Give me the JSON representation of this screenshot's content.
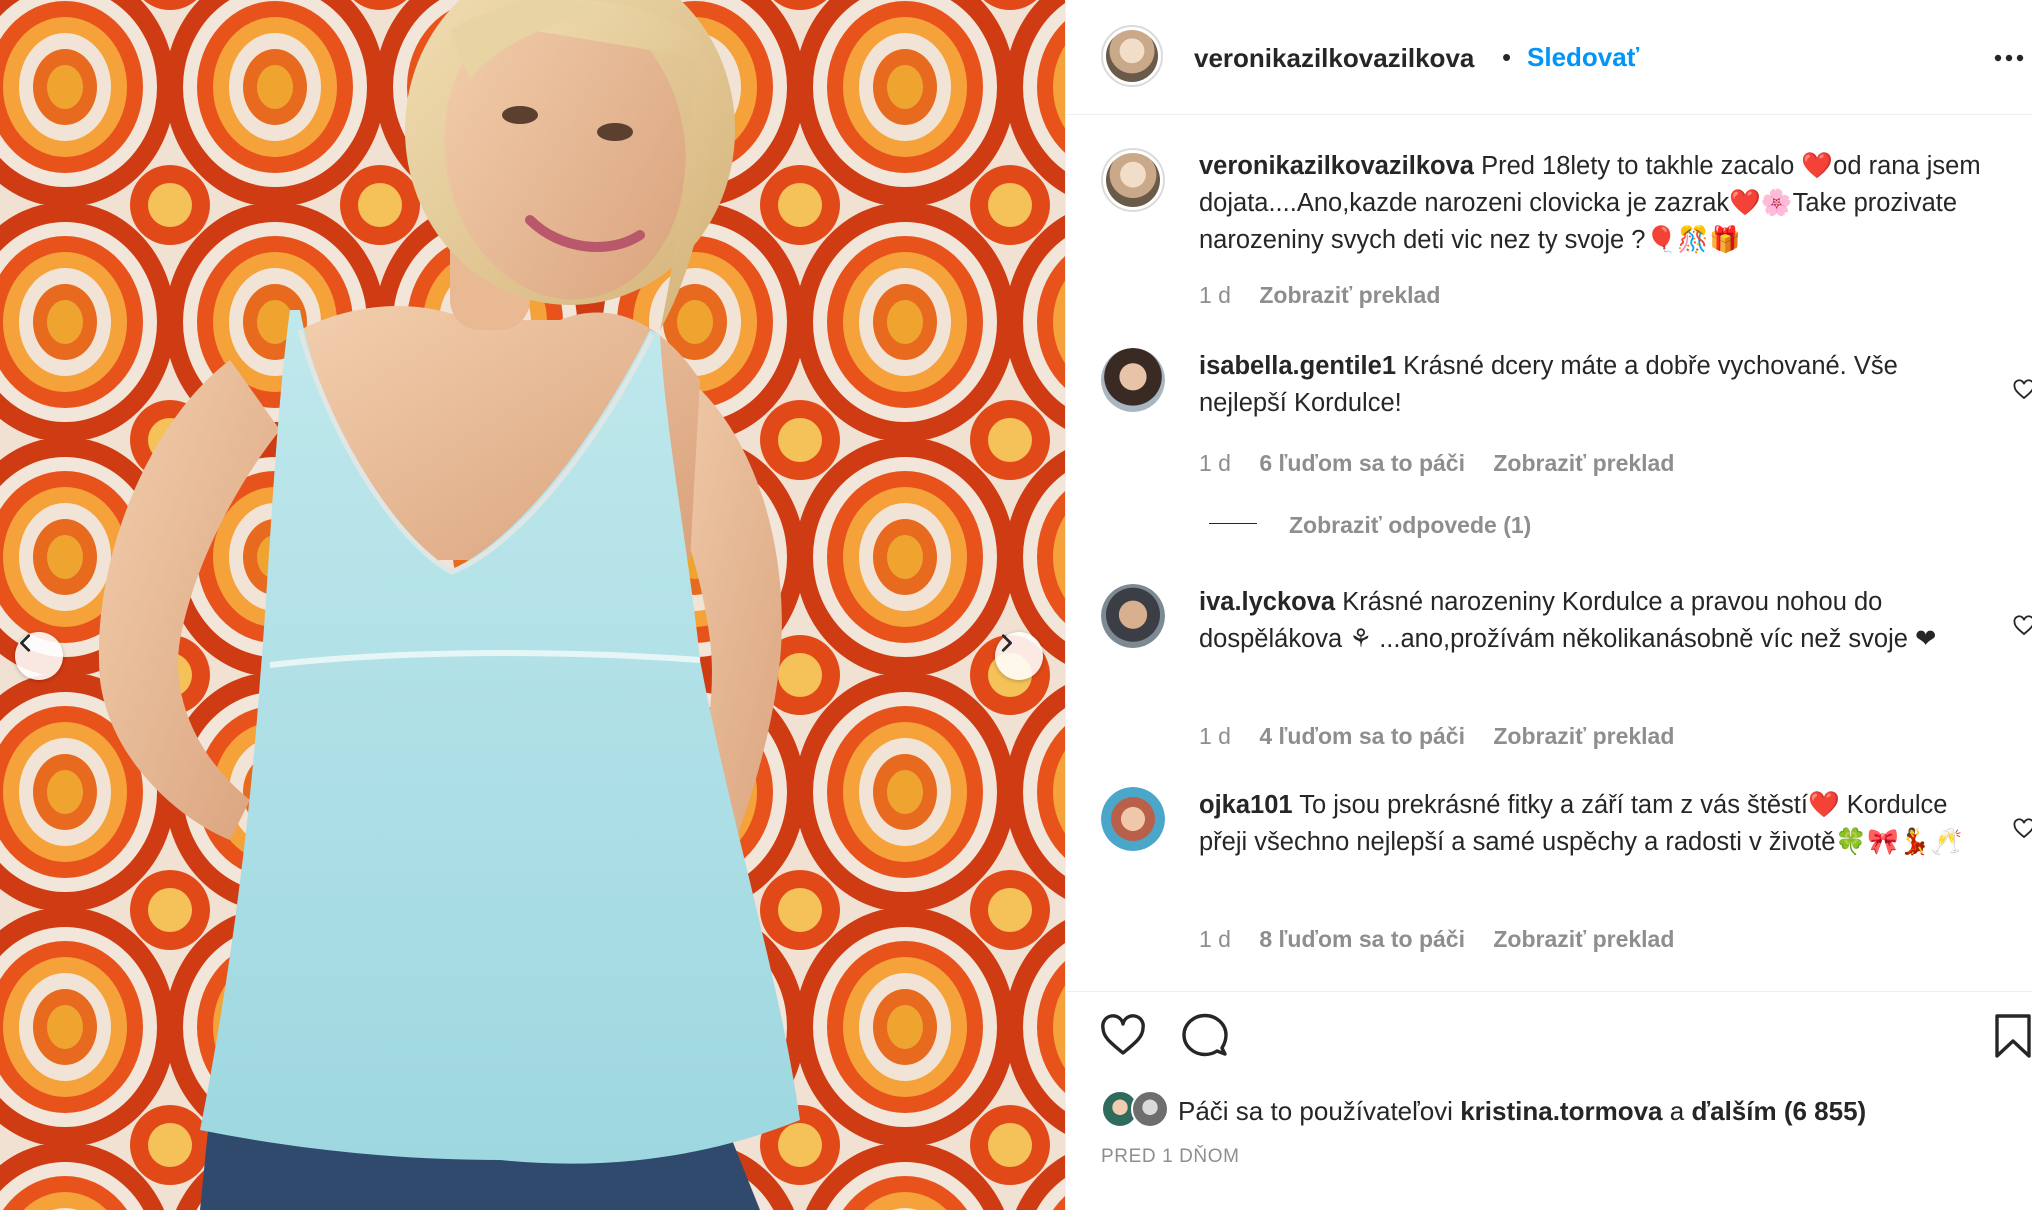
{
  "post": {
    "author": "veronikazilkovazilkova",
    "follow_label": "Sledovať",
    "separator": "•"
  },
  "caption": {
    "username": "veronikazilkovazilkova",
    "text": "Pred 18lety to takhle zacalo ❤️od rana jsem dojata....Ano,kazde narozeni clovicka je zazrak❤️🌸Take prozivate narozeniny svych deti vic nez ty svoje ?🎈🎊🎁",
    "time": "1 d",
    "translate": "Zobraziť preklad"
  },
  "comments": [
    {
      "username": "isabella.gentile1",
      "text": "Krásné dcery máte a dobře vychované. Vše nejlepší Kordulce!",
      "time": "1 d",
      "likes": "6 ľuďom sa to páči",
      "translate": "Zobraziť preklad"
    },
    {
      "username": "iva.lyckova",
      "text": "Krásné narozeniny Kordulce a pravou nohou do dospělákova ⚘ ...ano,prožívám několikanásobně víc než svoje ❤",
      "time": "1 d",
      "likes": "4 ľuďom sa to páči",
      "translate": "Zobraziť preklad"
    },
    {
      "username": "ojka101",
      "text": "To jsou prekrásné fitky a září tam z vás štěstí❤️ Kordulce přeji všechno nejlepší a samé uspěchy a radosti v životě🍀🎀💃🥂",
      "time": "1 d",
      "likes": "8 ľuďom sa to páči",
      "translate": "Zobraziť preklad"
    }
  ],
  "replies_label": "Zobraziť odpovede (1)",
  "footer": {
    "likes_prefix": "Páči sa to používateľovi",
    "liker": "kristina.tormova",
    "likes_and": "a",
    "likes_others": "ďalším (6 855)",
    "date": "PRED 1 DŇOM"
  },
  "colors": {
    "accent": "#0095f6",
    "text": "#262626",
    "muted": "#8e8e8e",
    "divider": "#efefef"
  },
  "icons": {
    "prev": "chevron-left-icon",
    "next": "chevron-right-icon",
    "more": "more-horizontal-icon",
    "like": "heart-icon",
    "comment": "comment-icon",
    "save": "bookmark-icon"
  }
}
